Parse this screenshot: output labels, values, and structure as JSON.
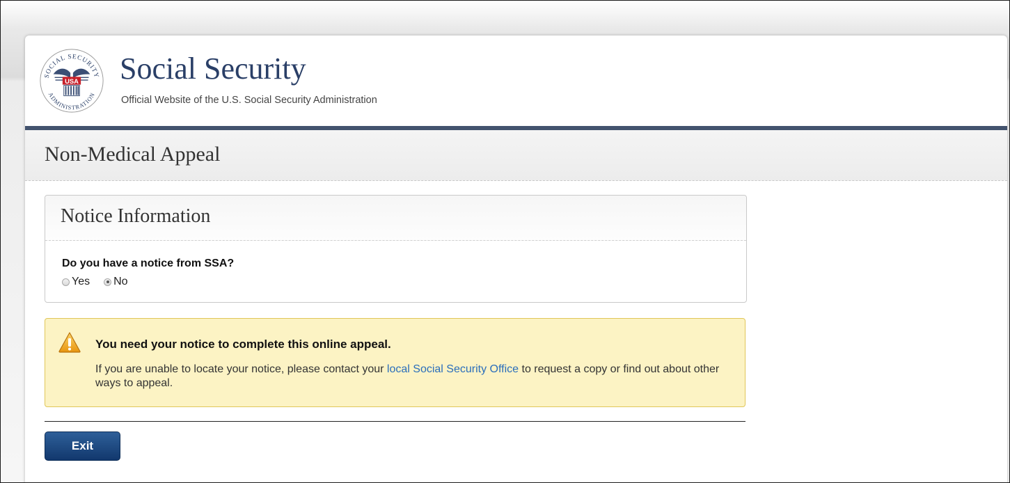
{
  "header": {
    "title": "Social Security",
    "subtitle": "Official Website of the U.S. Social Security Administration",
    "seal_text": "SOCIAL SECURITY ADMINISTRATION",
    "seal_badge": "USA"
  },
  "page": {
    "title": "Non-Medical Appeal"
  },
  "notice_panel": {
    "title": "Notice Information",
    "question": "Do you have a notice from SSA?",
    "options": [
      {
        "label": "Yes",
        "selected": false
      },
      {
        "label": "No",
        "selected": true
      }
    ]
  },
  "alert": {
    "icon": "warning-icon",
    "title": "You need your notice to complete this online appeal.",
    "text_before": "If you are unable to locate your notice, please contact your ",
    "link_text": "local Social Security Office",
    "text_after": " to request a copy or find out about other ways to appeal."
  },
  "actions": {
    "exit_label": "Exit"
  },
  "colors": {
    "brand_navy": "#2a3f67",
    "header_rule": "#43536e",
    "alert_bg": "#fcf3c4",
    "alert_border": "#e0c658",
    "link": "#2a6ebb",
    "button": "#1f4a85"
  }
}
